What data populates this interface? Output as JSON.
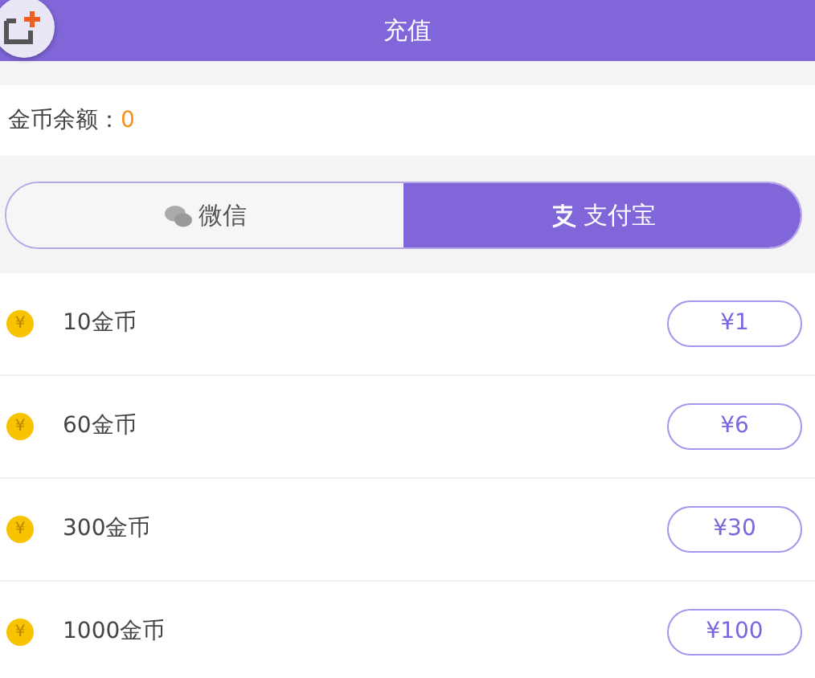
{
  "header": {
    "title": "充值"
  },
  "balance": {
    "label": "金币余额：",
    "value": "0"
  },
  "tabs": [
    {
      "kind": "wechat",
      "label": "微信",
      "selected": false
    },
    {
      "kind": "alipay",
      "label": "支付宝",
      "selected": true
    }
  ],
  "packages": [
    {
      "coin_symbol": "¥",
      "name": "10金币",
      "price": "¥1"
    },
    {
      "coin_symbol": "¥",
      "name": "60金币",
      "price": "¥6"
    },
    {
      "coin_symbol": "¥",
      "name": "300金币",
      "price": "¥30"
    },
    {
      "coin_symbol": "¥",
      "name": "1000金币",
      "price": "¥100"
    }
  ]
}
